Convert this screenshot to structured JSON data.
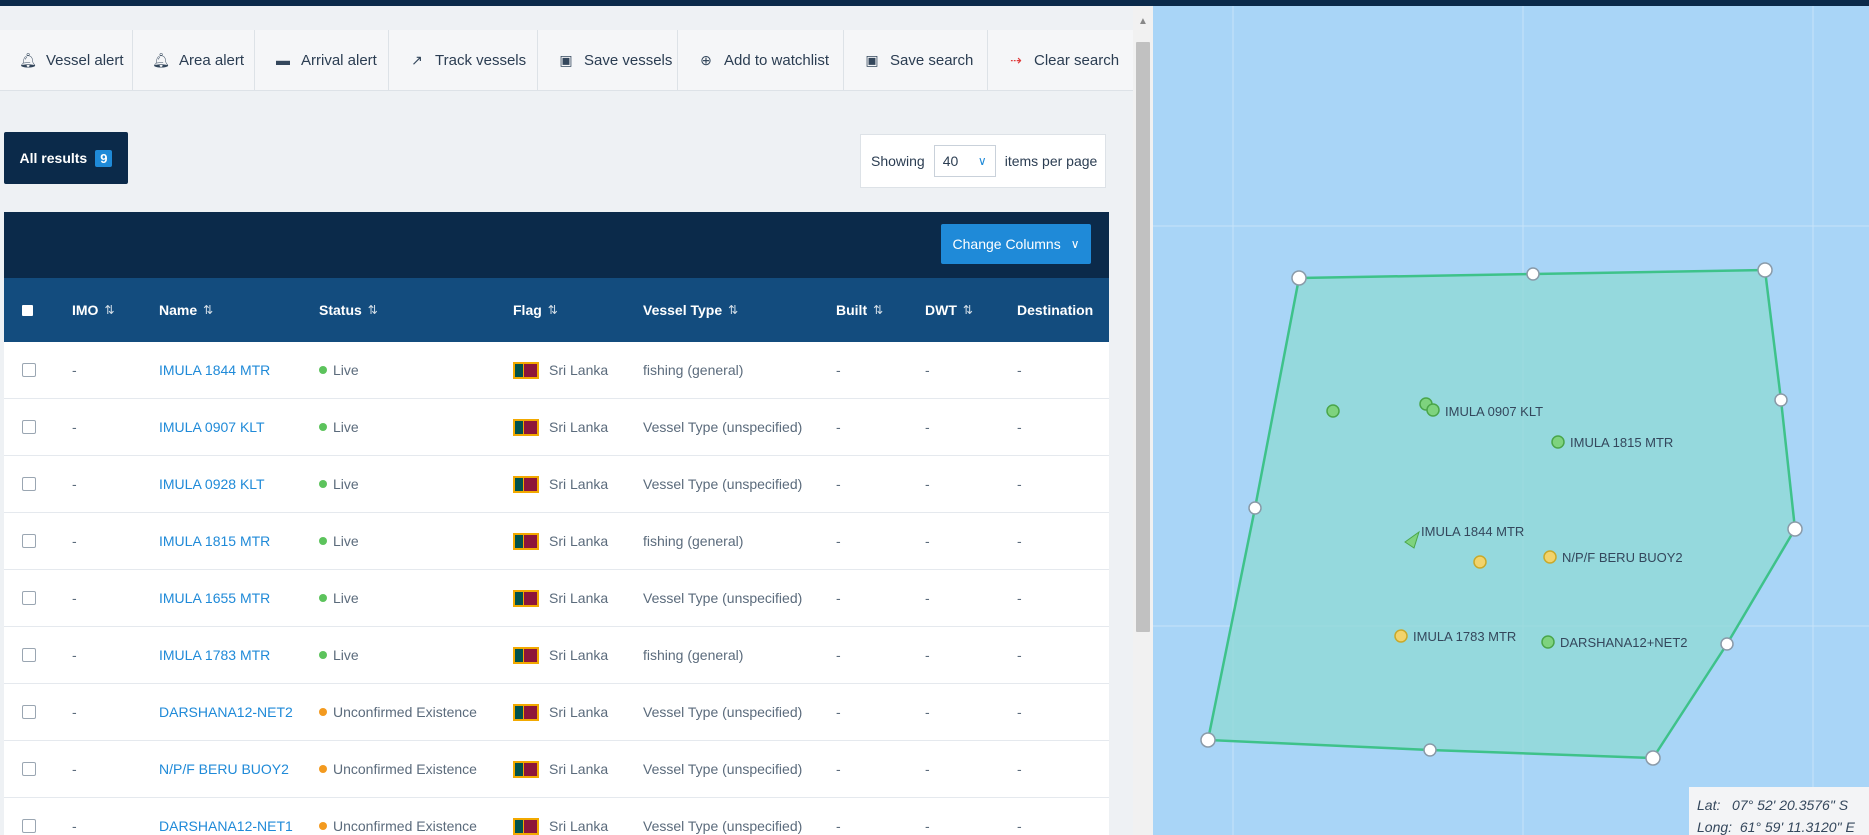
{
  "toolbar": {
    "items": [
      {
        "label": "Vessel alert",
        "icon": "bell-icon"
      },
      {
        "label": "Area alert",
        "icon": "bell-icon"
      },
      {
        "label": "Arrival alert",
        "icon": "ship-icon"
      },
      {
        "label": "Track vessels",
        "icon": "track-icon"
      },
      {
        "label": "Save vessels",
        "icon": "save-icon"
      },
      {
        "label": "Add to watchlist",
        "icon": "plus-circle-icon"
      },
      {
        "label": "Save search",
        "icon": "save-icon"
      },
      {
        "label": "Clear search",
        "icon": "clear-icon"
      }
    ]
  },
  "results": {
    "label": "All results",
    "count": "9"
  },
  "pagination": {
    "showing_label": "Showing",
    "per_page_value": "40",
    "items_label": "items per page"
  },
  "change_columns_label": "Change Columns",
  "table": {
    "columns": [
      "IMO",
      "Name",
      "Status",
      "Flag",
      "Vessel Type",
      "Built",
      "DWT",
      "Destination"
    ],
    "rows": [
      {
        "imo": "-",
        "name": "IMULA 1844 MTR",
        "status": "Live",
        "flag": "Sri Lanka",
        "type": "fishing (general)",
        "built": "-",
        "dwt": "-",
        "destination": "-"
      },
      {
        "imo": "-",
        "name": "IMULA 0907 KLT",
        "status": "Live",
        "flag": "Sri Lanka",
        "type": "Vessel Type (unspecified)",
        "built": "-",
        "dwt": "-",
        "destination": "-"
      },
      {
        "imo": "-",
        "name": "IMULA 0928 KLT",
        "status": "Live",
        "flag": "Sri Lanka",
        "type": "Vessel Type (unspecified)",
        "built": "-",
        "dwt": "-",
        "destination": "-"
      },
      {
        "imo": "-",
        "name": "IMULA 1815 MTR",
        "status": "Live",
        "flag": "Sri Lanka",
        "type": "fishing (general)",
        "built": "-",
        "dwt": "-",
        "destination": "-"
      },
      {
        "imo": "-",
        "name": "IMULA 1655 MTR",
        "status": "Live",
        "flag": "Sri Lanka",
        "type": "Vessel Type (unspecified)",
        "built": "-",
        "dwt": "-",
        "destination": "-"
      },
      {
        "imo": "-",
        "name": "IMULA 1783 MTR",
        "status": "Live",
        "flag": "Sri Lanka",
        "type": "fishing (general)",
        "built": "-",
        "dwt": "-",
        "destination": "-"
      },
      {
        "imo": "-",
        "name": "DARSHANA12-NET2",
        "status": "Unconfirmed Existence",
        "flag": "Sri Lanka",
        "type": "Vessel Type (unspecified)",
        "built": "-",
        "dwt": "-",
        "destination": "-"
      },
      {
        "imo": "-",
        "name": "N/P/F BERU BUOY2",
        "status": "Unconfirmed Existence",
        "flag": "Sri Lanka",
        "type": "Vessel Type (unspecified)",
        "built": "-",
        "dwt": "-",
        "destination": "-"
      },
      {
        "imo": "-",
        "name": "DARSHANA12-NET1",
        "status": "Unconfirmed Existence",
        "flag": "Sri Lanka",
        "type": "Vessel Type (unspecified)",
        "built": "-",
        "dwt": "-",
        "destination": "-"
      }
    ]
  },
  "status_colors": {
    "Live": "#5cc35c",
    "Unconfirmed Existence": "#f39a1f"
  },
  "map": {
    "vessel_labels": [
      "IMULA 0907 KLT",
      "IMULA 1815 MTR",
      "IMULA 1844 MTR",
      "N/P/F BERU BUOY2",
      "IMULA 1783 MTR",
      "DARSHANA12+NET2"
    ],
    "lat_label": "Lat:",
    "lat_value": "07° 52' 20.3576\" S",
    "lon_label": "Long:",
    "lon_value": "61° 59' 11.3120\" E"
  }
}
